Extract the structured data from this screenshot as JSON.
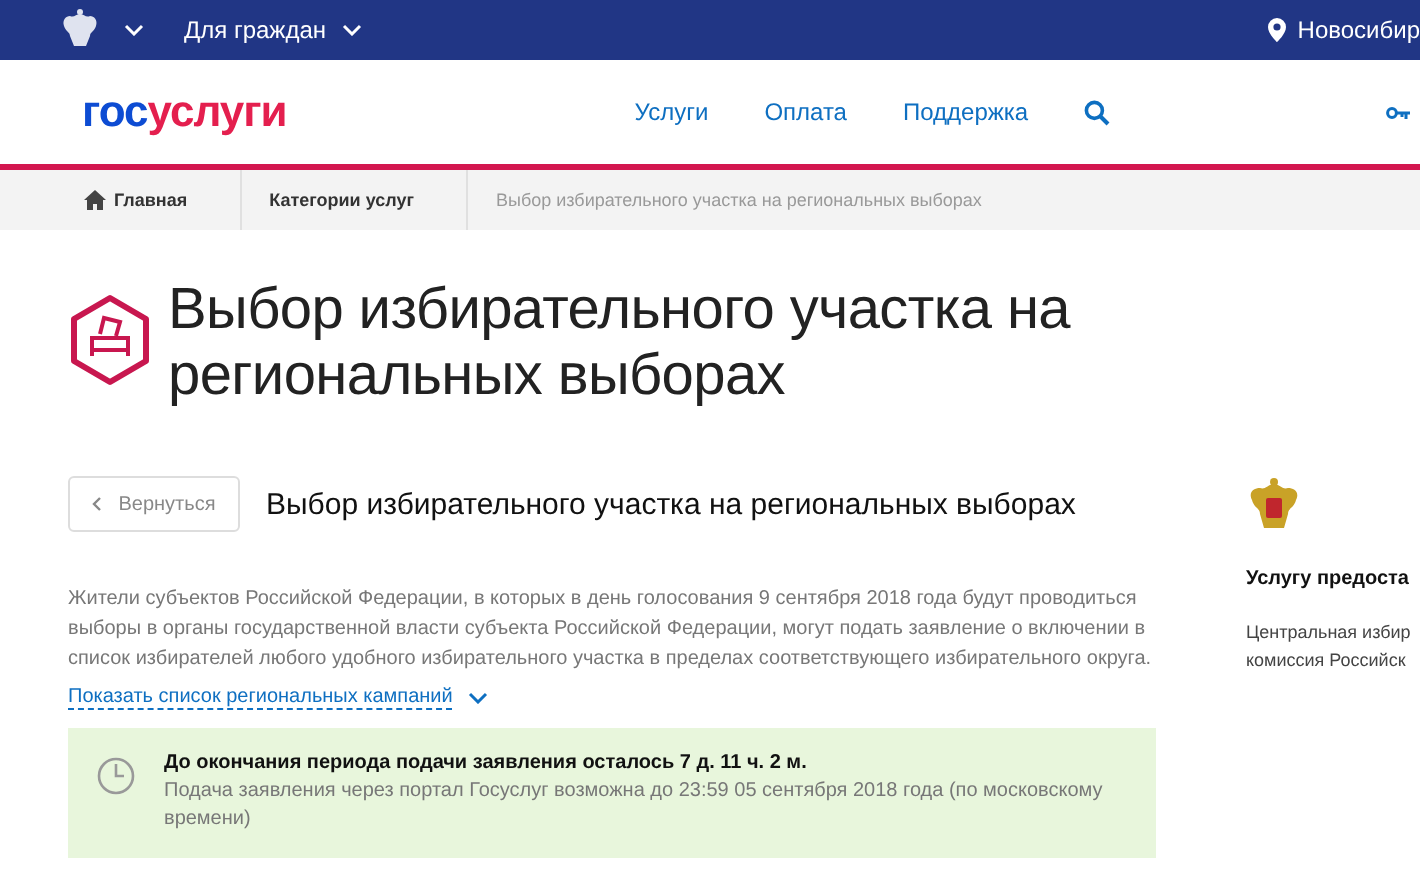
{
  "top_bar": {
    "audience_menu": "Для граждан",
    "location": "Новосибир"
  },
  "header": {
    "logo": {
      "first": "гос",
      "second": "услуги"
    },
    "nav": [
      "Услуги",
      "Оплата",
      "Поддержка"
    ]
  },
  "breadcrumbs": [
    {
      "label": "Главная",
      "kind": "home"
    },
    {
      "label": "Категории услуг",
      "kind": "link"
    },
    {
      "label": "Выбор избирательного участка на региональных выборах",
      "kind": "current"
    }
  ],
  "page_title": "Выбор избирательного участка на региональных выборах",
  "back_button": "Вернуться",
  "service_title": "Выбор избирательного участка на региональных выборах",
  "description": "Жители субъектов Российской Федерации, в которых в день голосования 9 сентября 2018 года будут проводиться выборы в органы государственной власти субъекта Российской Федерации, могут подать заявление о включении в список избирателей любого удобного избирательного участка в пределах соответствующего избирательного округа.",
  "campaigns_link": "Показать список региональных кампаний",
  "deadline": {
    "title": "До окончания периода подачи заявления осталось 7 д. 11 ч. 2 м.",
    "note": "Подача заявления через портал Госуслуг возможна до 23:59 05 сентября 2018 года (по московскому времени)"
  },
  "provider": {
    "heading": "Услугу предоста",
    "lines": [
      "Центральная избир",
      "комиссия Российск"
    ]
  }
}
